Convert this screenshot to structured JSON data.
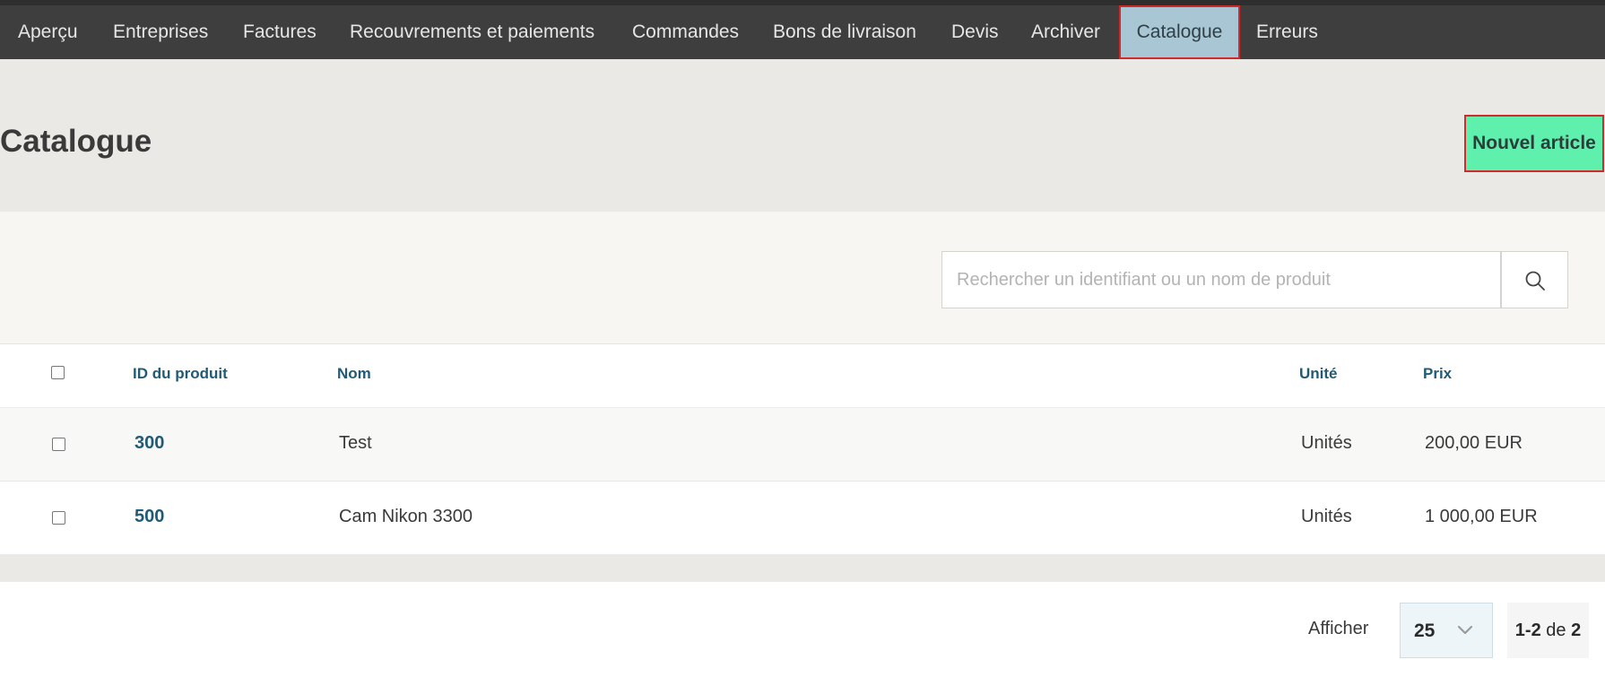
{
  "nav": {
    "items": [
      {
        "label": "Aperçu"
      },
      {
        "label": "Entreprises"
      },
      {
        "label": "Factures"
      },
      {
        "label": "Recouvrements et paiements"
      },
      {
        "label": "Commandes"
      },
      {
        "label": "Bons de livraison"
      },
      {
        "label": "Devis"
      },
      {
        "label": "Archiver"
      },
      {
        "label": "Catalogue"
      },
      {
        "label": "Erreurs"
      }
    ],
    "active": "Catalogue"
  },
  "header": {
    "title": "Catalogue",
    "new_button": "Nouvel article"
  },
  "search": {
    "placeholder": "Rechercher un identifiant ou un nom de produit",
    "value": "",
    "icon": "search-icon"
  },
  "table": {
    "columns": [
      "ID du produit",
      "Nom",
      "Unité",
      "Prix"
    ],
    "rows": [
      {
        "id": "300",
        "name": "Test",
        "unit": "Unités",
        "price": "200,00 EUR"
      },
      {
        "id": "500",
        "name": "Cam Nikon 3300",
        "unit": "Unités",
        "price": "1 000,00 EUR"
      }
    ]
  },
  "pagination": {
    "label": "Afficher",
    "page_size": "25",
    "range_start": "1-2",
    "range_of": "de",
    "range_total": "2"
  },
  "colors": {
    "nav_bg": "#3e3e3e",
    "nav_active": "#a8c6d3",
    "accent_button": "#5ff0ae",
    "link": "#1f5a76",
    "highlight_border": "#d12a2a"
  }
}
